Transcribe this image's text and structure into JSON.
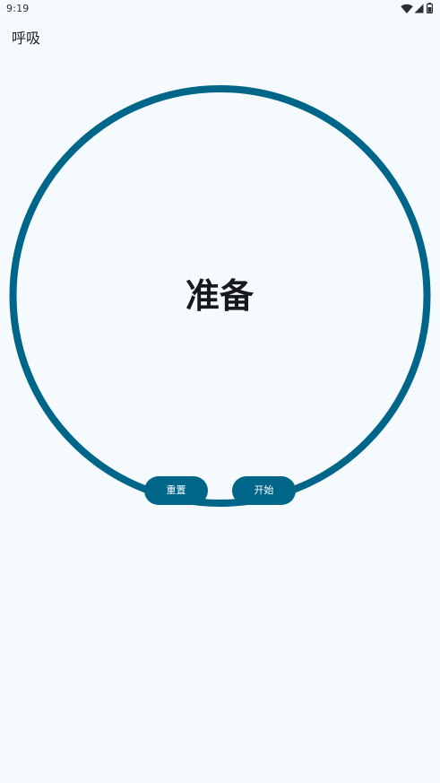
{
  "status_bar": {
    "time": "9:19",
    "icons": [
      "wifi-icon",
      "signal-icon",
      "battery-icon"
    ]
  },
  "app": {
    "title": "呼吸"
  },
  "breathing": {
    "phase": "准备",
    "ring_color": "#006689",
    "progress": 1.0
  },
  "controls": {
    "reset_label": "重置",
    "start_label": "开始",
    "button_color": "#006689"
  }
}
